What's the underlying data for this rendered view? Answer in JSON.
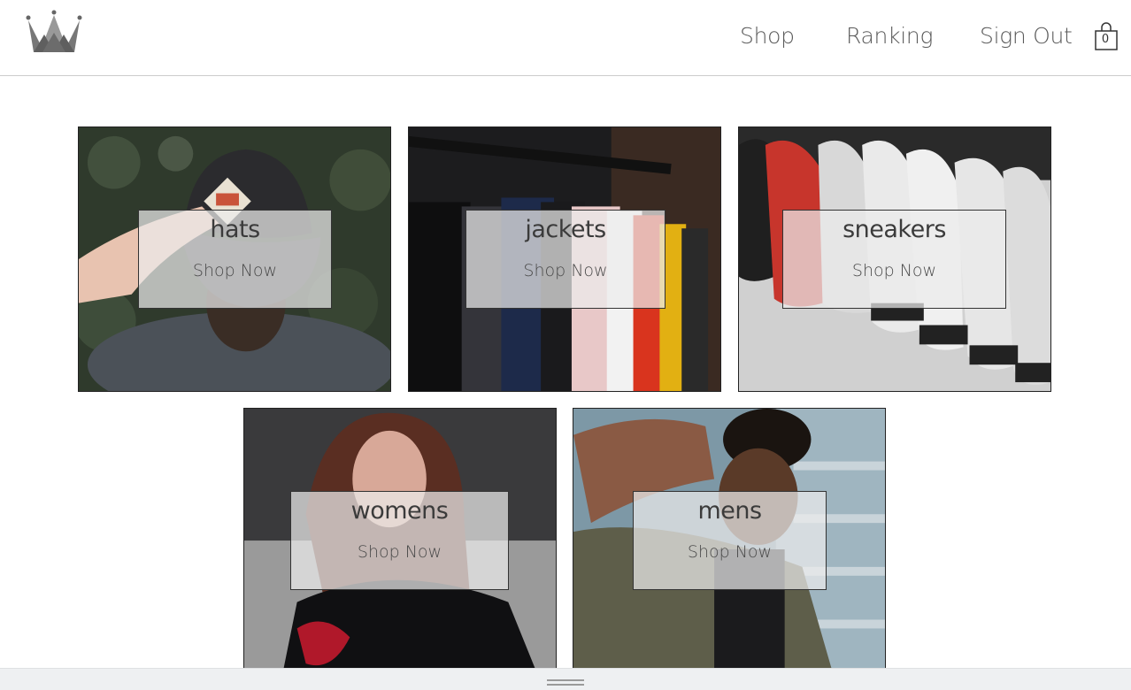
{
  "nav": {
    "logo_icon": "crown-icon",
    "shop": "Shop",
    "ranking": "Ranking",
    "sign_out": "Sign Out",
    "cart_icon": "shopping-bag-icon",
    "cart_count": "0"
  },
  "categories": [
    {
      "title": "hats",
      "cta": "Shop Now"
    },
    {
      "title": "jackets",
      "cta": "Shop Now"
    },
    {
      "title": "sneakers",
      "cta": "Shop Now"
    },
    {
      "title": "womens",
      "cta": "Shop Now"
    },
    {
      "title": "mens",
      "cta": "Shop Now"
    }
  ],
  "colors": {
    "overlay": "#ebebeb",
    "text": "#3b3b3b",
    "border": "#222222"
  }
}
